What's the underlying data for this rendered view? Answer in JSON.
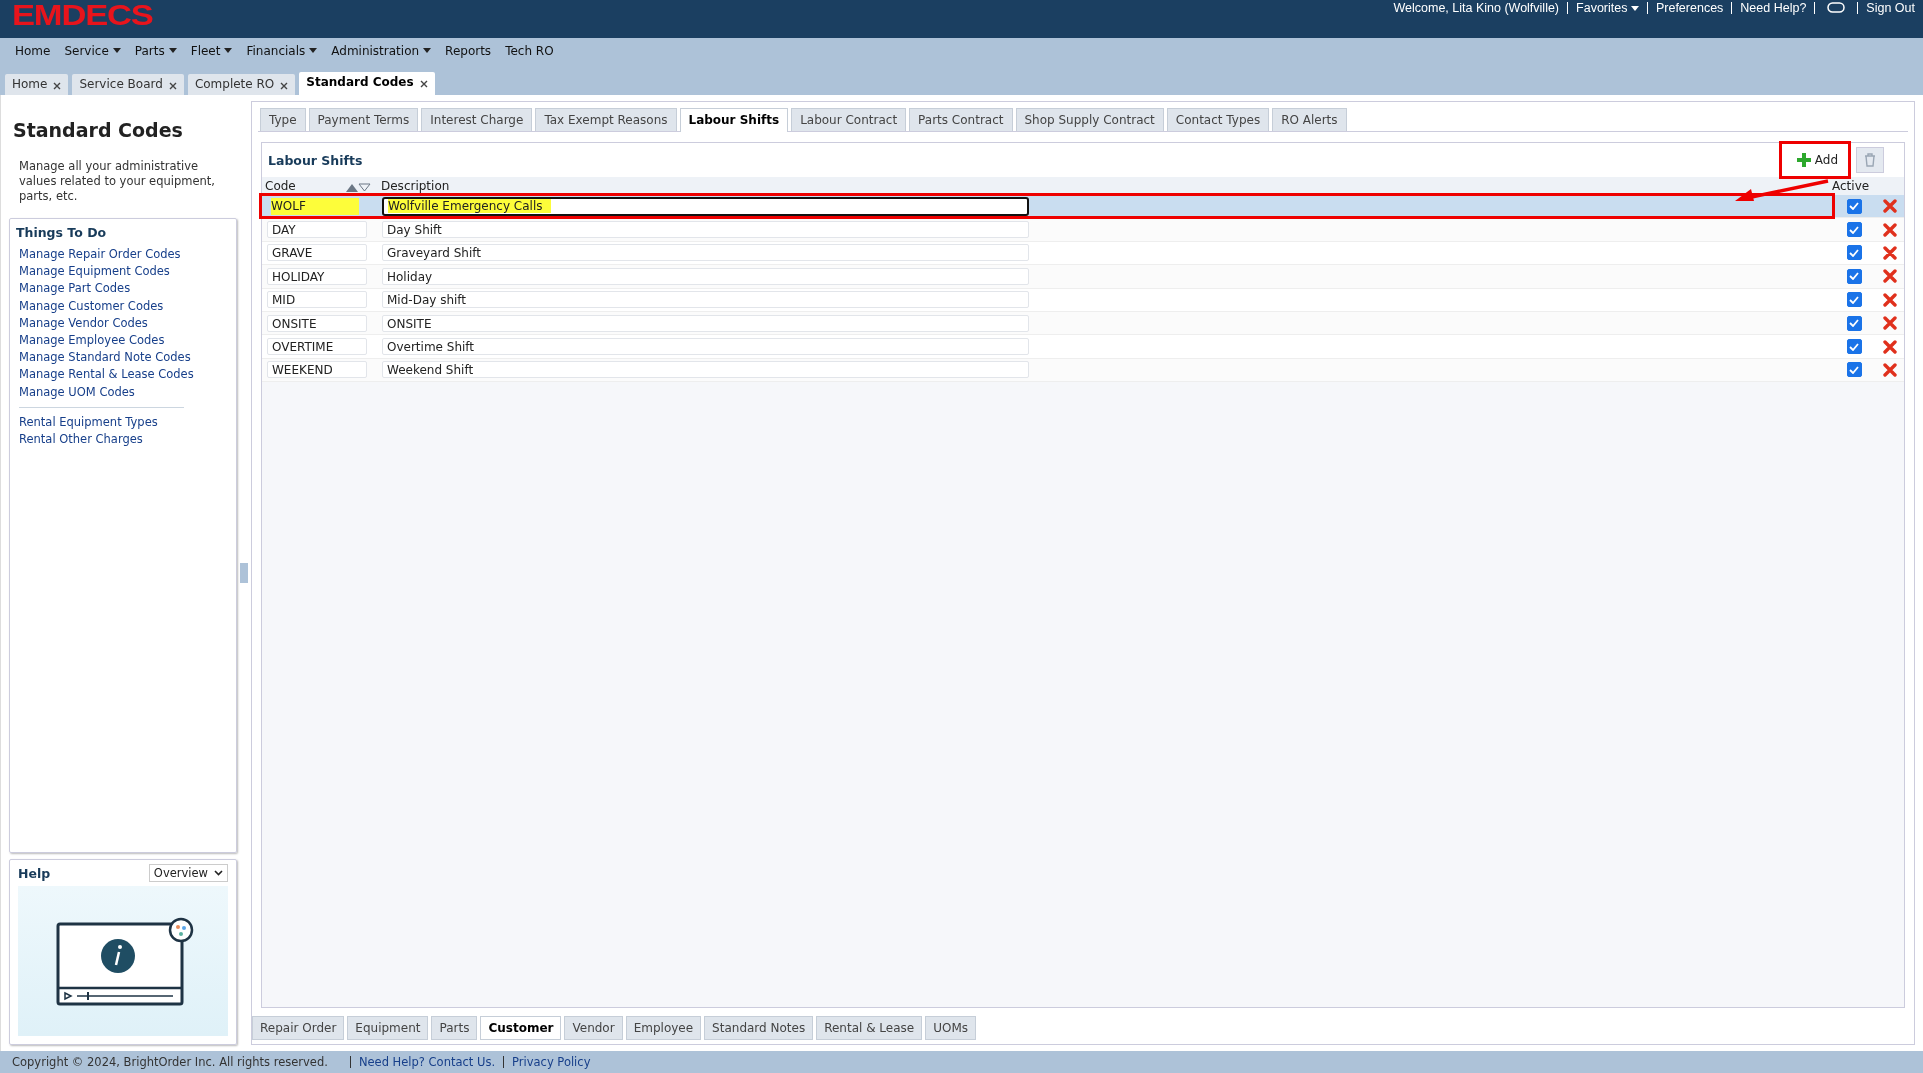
{
  "header": {
    "logo": "EMDECS",
    "links": [
      {
        "label": "Welcome, Lita Kino (Wolfville)",
        "kind": "text"
      },
      {
        "label": "Favorites",
        "kind": "dropdown"
      },
      {
        "label": "Preferences",
        "kind": "link"
      },
      {
        "label": "Need Help?",
        "kind": "link"
      },
      {
        "kind": "chat"
      },
      {
        "label": "Sign Out",
        "kind": "link"
      }
    ]
  },
  "menu": [
    {
      "label": "Home",
      "dropdown": false
    },
    {
      "label": "Service",
      "dropdown": true
    },
    {
      "label": "Parts",
      "dropdown": true
    },
    {
      "label": "Fleet",
      "dropdown": true
    },
    {
      "label": "Financials",
      "dropdown": true
    },
    {
      "label": "Administration",
      "dropdown": true
    },
    {
      "label": "Reports",
      "dropdown": false
    },
    {
      "label": "Tech RO",
      "dropdown": false
    }
  ],
  "page_tabs": [
    {
      "label": "Home",
      "selected": false
    },
    {
      "label": "Service Board",
      "selected": false
    },
    {
      "label": "Complete RO",
      "selected": false
    },
    {
      "label": "Standard Codes",
      "selected": true
    }
  ],
  "sidebar": {
    "title": "Standard Codes",
    "description": "Manage all your administrative values related to your equipment, parts, etc.",
    "todo_title": "Things To Do",
    "links": [
      "Manage Repair Order Codes",
      "Manage Equipment Codes",
      "Manage Part Codes",
      "Manage Customer Codes",
      "Manage Vendor Codes",
      "Manage Employee Codes",
      "Manage Standard Note Codes",
      "Manage Rental & Lease Codes",
      "Manage UOM Codes"
    ],
    "links_2": [
      "Rental Equipment Types",
      "Rental Other Charges"
    ],
    "help": {
      "title": "Help",
      "select": "Overview"
    }
  },
  "code_tabs": [
    {
      "label": "Type",
      "selected": false
    },
    {
      "label": "Payment Terms",
      "selected": false
    },
    {
      "label": "Interest Charge",
      "selected": false
    },
    {
      "label": "Tax Exempt Reasons",
      "selected": false
    },
    {
      "label": "Labour Shifts",
      "selected": true
    },
    {
      "label": "Labour Contract",
      "selected": false
    },
    {
      "label": "Parts Contract",
      "selected": false
    },
    {
      "label": "Shop Supply Contract",
      "selected": false
    },
    {
      "label": "Contact Types",
      "selected": false
    },
    {
      "label": "RO Alerts",
      "selected": false
    }
  ],
  "grid": {
    "title": "Labour Shifts",
    "add_button": "Add",
    "columns": [
      "Code",
      "Description",
      "Active"
    ],
    "rows": [
      {
        "code": "WOLF",
        "description": "Wolfville Emergency Calls",
        "active": true,
        "selected": true
      },
      {
        "code": "DAY",
        "description": "Day Shift",
        "active": true,
        "selected": false
      },
      {
        "code": "GRAVE",
        "description": "Graveyard Shift",
        "active": true,
        "selected": false
      },
      {
        "code": "HOLIDAY",
        "description": "Holiday",
        "active": true,
        "selected": false
      },
      {
        "code": "MID",
        "description": "Mid-Day shift",
        "active": true,
        "selected": false
      },
      {
        "code": "ONSITE",
        "description": "ONSITE",
        "active": true,
        "selected": false
      },
      {
        "code": "OVERTIME",
        "description": "Overtime Shift",
        "active": true,
        "selected": false
      },
      {
        "code": "WEEKEND",
        "description": "Weekend Shift",
        "active": true,
        "selected": false
      }
    ]
  },
  "bottom_tabs": [
    {
      "label": "Repair Order",
      "selected": false
    },
    {
      "label": "Equipment",
      "selected": false
    },
    {
      "label": "Parts",
      "selected": false
    },
    {
      "label": "Customer",
      "selected": true
    },
    {
      "label": "Vendor",
      "selected": false
    },
    {
      "label": "Employee",
      "selected": false
    },
    {
      "label": "Standard Notes",
      "selected": false
    },
    {
      "label": "Rental & Lease",
      "selected": false
    },
    {
      "label": "UOMs",
      "selected": false
    }
  ],
  "footer": {
    "copyright": "Copyright © 2024, BrightOrder Inc. All rights reserved.",
    "links": [
      "Need Help? Contact Us.",
      "Privacy Policy"
    ]
  }
}
